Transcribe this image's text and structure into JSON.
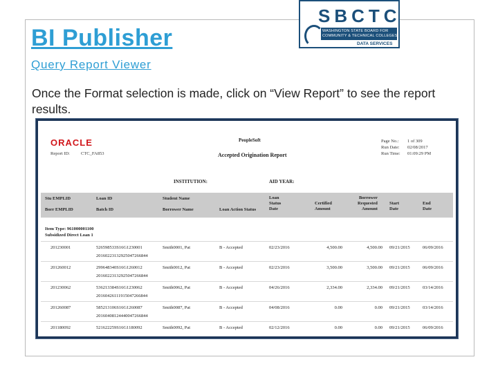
{
  "slide": {
    "title": "BI Publisher",
    "subtitle": "Query Report Viewer ",
    "body": "Once the Format selection is made, click on “View Report” to see the report results."
  },
  "logo": {
    "name": "SBCTC",
    "line1": "WASHINGTON STATE BOARD FOR",
    "line2": "COMMUNITY & TECHNICAL COLLEGES",
    "division": "DATA SERVICES"
  },
  "report": {
    "brand": "ORACLE",
    "report_id_label": "Report ID:",
    "report_id": "CTC_FA853",
    "vendor": "PeopleSoft",
    "title": "Accepted Origination Report",
    "page_no_label": "Page No.:",
    "page_no": "1 of 309",
    "run_date_label": "Run Date:",
    "run_date": "02/08/2017",
    "run_time_label": "Run Time:",
    "run_time": "01:09:29 PM",
    "institution_label": "INSTITUTION:",
    "aid_year_label": "AID YEAR:",
    "columns": {
      "stu": "Stu EMPLID",
      "bor": "Borr EMPLID",
      "loan_id": "Loan ID",
      "batch_id": "Batch ID",
      "student_name": "Student Name",
      "borrower_name": "Borrower Name",
      "action": "Loan Action Status",
      "loan_status_date": "Loan\nStatus\nDate",
      "certified": "Certified\nAmount",
      "borrower_requested": "Borrower\nRequested\nAmount",
      "start": "Start\nDate",
      "end": "End\nDate"
    },
    "item_type": "Item Type:  961000001100",
    "loan_type": "Subsidized Direct Loan 1",
    "rows": [
      {
        "stu": "201230001",
        "loan_id": "526598533S16G1230001",
        "batch_id": "20160223132925047266844",
        "student": "Smith0001, Pat",
        "action": "B  -  Accepted",
        "date": "02/23/2016",
        "certified": "4,500.00",
        "requested": "4,500.00",
        "start": "09/21/2015",
        "end": "06/09/2016"
      },
      {
        "stu": "201260012",
        "loan_id": "299648340S16G1260012",
        "batch_id": "20160223132925047266844",
        "student": "Smith0012, Pat",
        "action": "B  -  Accepted",
        "date": "02/23/2016",
        "certified": "3,500.00",
        "requested": "3,500.00",
        "start": "09/21/2015",
        "end": "06/09/2016"
      },
      {
        "stu": "201230062",
        "loan_id": "536213384S16G1230062",
        "batch_id": "20160426111915047266844",
        "student": "Smith0062, Pat",
        "action": "B  -  Accepted",
        "date": "04/26/2016",
        "certified": "2,334.00",
        "requested": "2,334.00",
        "start": "09/21/2015",
        "end": "03/14/2016"
      },
      {
        "stu": "201260087",
        "loan_id": "585213106S16G1260087",
        "batch_id": "20160408124440047266844",
        "student": "Smith0087, Pat",
        "action": "B  -  Accepted",
        "date": "04/08/2016",
        "certified": "0.00",
        "requested": "0.00",
        "start": "09/21/2015",
        "end": "03/14/2016"
      },
      {
        "stu": "201180092",
        "loan_id": "521622259S16G1180092",
        "batch_id": "",
        "student": "Smith0092, Pat",
        "action": "B  -  Accepted",
        "date": "02/12/2016",
        "certified": "0.00",
        "requested": "0.00",
        "start": "09/21/2015",
        "end": "06/09/2016"
      }
    ]
  }
}
